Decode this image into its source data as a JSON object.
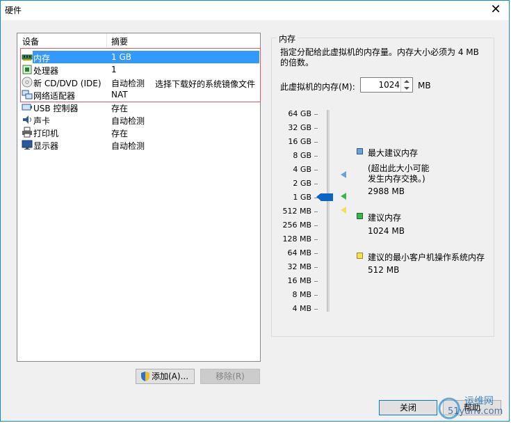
{
  "window": {
    "title": "硬件",
    "close_glyph": "✕"
  },
  "device_list": {
    "columns": [
      "设备",
      "摘要"
    ],
    "rows": [
      {
        "device": "内存",
        "summary": "1 GB",
        "icon": "memory-icon",
        "selected": true
      },
      {
        "device": "处理器",
        "summary": "1",
        "icon": "processor-icon"
      },
      {
        "device": "新 CD/DVD (IDE)",
        "summary": "自动检测",
        "icon": "cd-dvd-icon"
      },
      {
        "device": "网络适配器",
        "summary": "NAT",
        "icon": "network-adapter-icon"
      },
      {
        "device": "USB 控制器",
        "summary": "存在",
        "icon": "usb-icon"
      },
      {
        "device": "声卡",
        "summary": "自动检测",
        "icon": "sound-card-icon"
      },
      {
        "device": "打印机",
        "summary": "存在",
        "icon": "printer-icon"
      },
      {
        "device": "显示器",
        "summary": "自动检测",
        "icon": "display-icon"
      }
    ],
    "annotation": "选择下载好的系统镜像文件"
  },
  "buttons": {
    "add": "添加(A)...",
    "remove": "移除(R)",
    "close": "关闭",
    "help": "帮助"
  },
  "memory_panel": {
    "group_title": "内存",
    "description": "指定分配给此虚拟机的内存量。内存大小必须为 4 MB 的倍数。",
    "field_label": "此虚拟机的内存(M):",
    "field_value": "1024",
    "unit": "MB",
    "scale_labels": [
      "64 GB",
      "32 GB",
      "16 GB",
      "8 GB",
      "4 GB",
      "2 GB",
      "1 GB",
      "512 MB",
      "256 MB",
      "128 MB",
      "64 MB",
      "32 MB",
      "16 MB",
      "8 MB",
      "4 MB"
    ],
    "legend": {
      "max_title": "最大建议内存",
      "max_note_1": "(超出此大小可能",
      "max_note_2": "发生内存交换。)",
      "max_value": "2988 MB",
      "rec_title": "建议内存",
      "rec_value": "1024 MB",
      "min_title": "建议的最小客户机操作系统内存",
      "min_value": "512 MB"
    },
    "colors": {
      "max": "#6f9fd4",
      "rec": "#3cb44b",
      "min": "#f0e05a",
      "thumb": "#0a64c8"
    }
  },
  "watermark": {
    "text_1": "运维网",
    "text_2": "51yunv.com"
  }
}
